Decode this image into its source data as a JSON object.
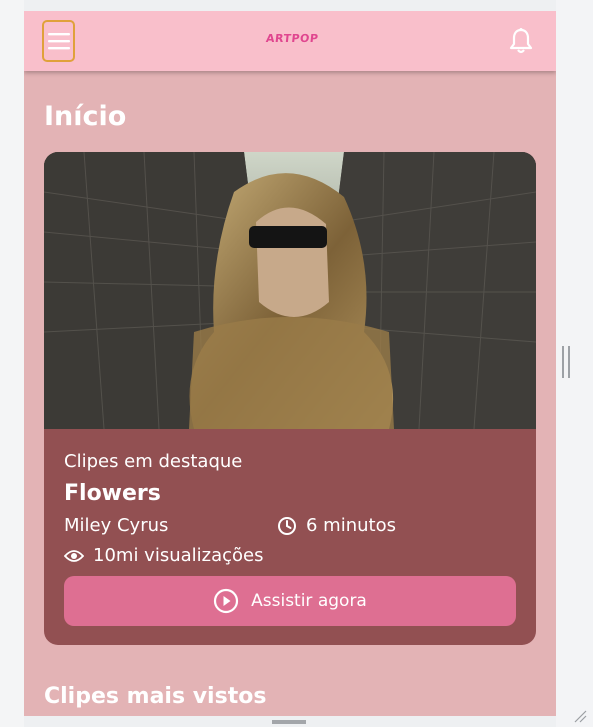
{
  "app": {
    "logo_text": "ARTPOP",
    "colors": {
      "topbar": "#f9bfcb",
      "background": "#e3b3b5",
      "card": "#925052",
      "button": "#de6f92",
      "logo": "#e0468f"
    }
  },
  "header": {
    "menu_icon": "hamburger-icon",
    "notification_icon": "bell-icon"
  },
  "page": {
    "title": "Início"
  },
  "featured": {
    "caption": "Clipes em destaque",
    "title": "Flowers",
    "artist": "Miley Cyrus",
    "duration": "6 minutos",
    "views": "10mi visualizações",
    "watch_label": "Assistir agora",
    "icons": {
      "duration": "clock-icon",
      "views": "eye-icon",
      "watch": "play-circle-icon"
    }
  },
  "sections": {
    "most_viewed": "Clipes mais vistos"
  }
}
